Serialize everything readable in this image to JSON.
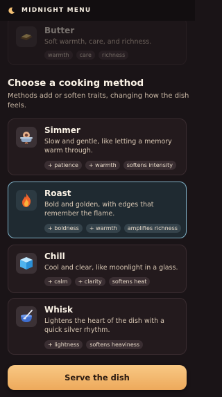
{
  "app": {
    "title": "MIDNIGHT MENU"
  },
  "ingredient": {
    "title": "Butter",
    "desc": "Soft warmth, care, and richness.",
    "tags": [
      "warmth",
      "care",
      "richness"
    ]
  },
  "section": {
    "title": "Choose a cooking method",
    "desc": "Methods add or soften traits, changing how the dish feels."
  },
  "methods": [
    {
      "title": "Simmer",
      "desc": "Slow and gentle, like letting a memory warm through.",
      "tags": [
        "+ patience",
        "+ warmth",
        "softens intensity"
      ],
      "icon": "pot-icon",
      "selected": false
    },
    {
      "title": "Roast",
      "desc": "Bold and golden, with edges that remember the flame.",
      "tags": [
        "+ boldness",
        "+ warmth",
        "amplifies richness"
      ],
      "icon": "flame-icon",
      "selected": true
    },
    {
      "title": "Chill",
      "desc": "Cool and clear, like moonlight in a glass.",
      "tags": [
        "+ calm",
        "+ clarity",
        "softens heat"
      ],
      "icon": "ice-cube-icon",
      "selected": false
    },
    {
      "title": "Whisk",
      "desc": "Lightens the heart of the dish with a quick silver rhythm.",
      "tags": [
        "+ lightness",
        "softens heaviness"
      ],
      "icon": "whisk-icon",
      "selected": false
    }
  ],
  "action": {
    "serve_label": "Serve the dish"
  },
  "colors": {
    "accent": "#f3b96c",
    "selected_border": "#7fb1c7",
    "background": "#1a1417"
  }
}
